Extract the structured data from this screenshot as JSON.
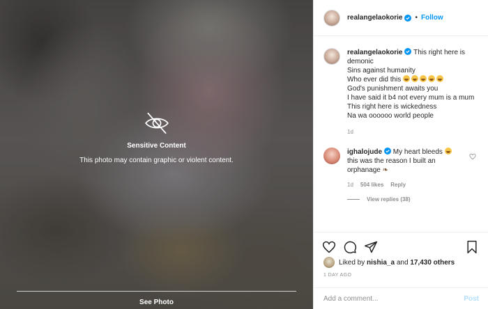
{
  "media": {
    "sensitive_title": "Sensitive Content",
    "sensitive_description": "This photo may contain graphic or violent content.",
    "see_photo_label": "See Photo",
    "eye_icon": "eye-off-icon"
  },
  "header": {
    "username": "realangelaokorie",
    "separator": "•",
    "follow_label": "Follow"
  },
  "caption": {
    "username": "realangelaokorie",
    "lines": [
      "This right here is demonic",
      "Sins against humanity",
      "Who ever did this",
      "God's punishment awaits you",
      "I have said it b4 not every mum is a mum",
      "This right here is wickedness",
      "Na wa oooooo world people"
    ],
    "time": "1d"
  },
  "comment": {
    "username": "ighalojude",
    "text_part1": "My heart bleeds",
    "text_part2": "this was the reason I built an orphanage",
    "time": "1d",
    "likes": "504 likes",
    "reply_label": "Reply",
    "view_replies": "View replies (38)"
  },
  "likes": {
    "prefix": "Liked by",
    "user": "nishia_a",
    "and": "and",
    "others": "17,430 others"
  },
  "post_time": "1 DAY AGO",
  "add_comment": {
    "placeholder": "Add a comment...",
    "post_label": "Post"
  },
  "colors": {
    "accent": "#0095f6",
    "post_disabled": "#b2dffc",
    "muted": "#8e8e8e"
  }
}
